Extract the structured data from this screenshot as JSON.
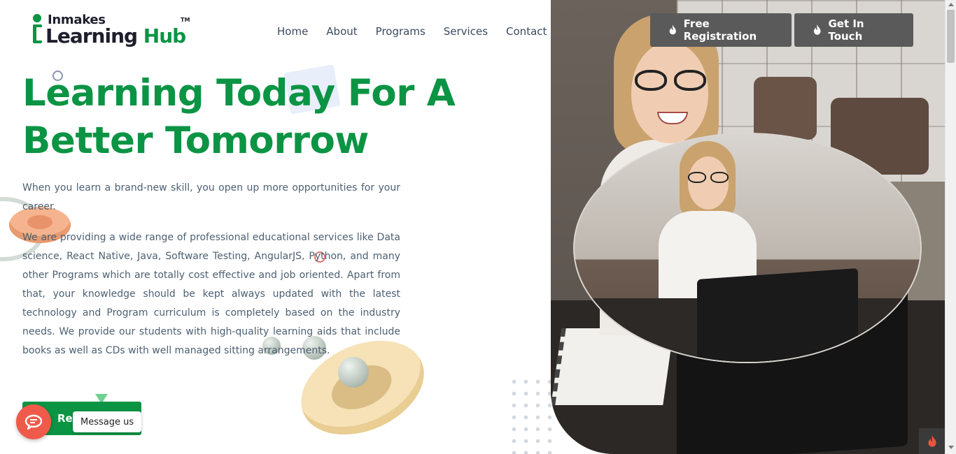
{
  "logo": {
    "top": "Inmakes",
    "main": "Learning",
    "hub": "Hub",
    "tm": "TM"
  },
  "nav": {
    "items": [
      {
        "label": "Home"
      },
      {
        "label": "About"
      },
      {
        "label": "Programs"
      },
      {
        "label": "Services"
      },
      {
        "label": "Contact"
      }
    ]
  },
  "header_buttons": {
    "free_registration": "Free Registration",
    "get_in_touch": "Get In Touch",
    "icon": "flame-icon"
  },
  "hero": {
    "title": "Learning Today For A Better Tomorrow",
    "paragraph1": "When you learn a brand-new skill, you open up more opportunities for your career.",
    "paragraph2": "We are providing a wide range of professional educational services like Data science, React Native, Java, Software Testing, AngularJS, Python, and many other Programs which are totally cost effective and job oriented. Apart from that, your knowledge should be kept always updated with the latest technology and Program curriculum is completely based on the industry needs. We provide our students with high-quality learning aids that include books as well as CDs with well managed sitting arrangements.",
    "cta_label": "Re"
  },
  "chat": {
    "label": "Message us",
    "icon": "chat-bubble-icon"
  },
  "colors": {
    "brand_green": "#0b9444",
    "button_gray": "#5a5a5a",
    "chat_red": "#ef5a4a",
    "body_text": "#4d6072"
  }
}
